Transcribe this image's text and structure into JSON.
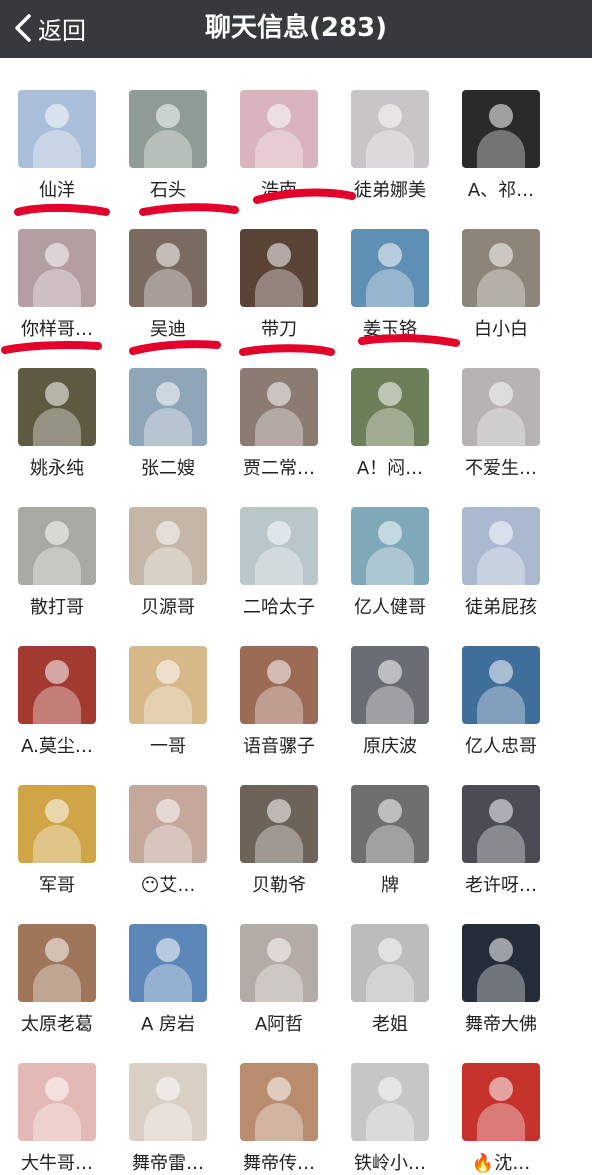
{
  "header": {
    "back_label": "返回",
    "title": "聊天信息(283)"
  },
  "members": [
    {
      "name": "仙洋",
      "color": "#a9bfd9"
    },
    {
      "name": "石头",
      "color": "#8f9b96"
    },
    {
      "name": "浩南",
      "color": "#d9b3bd"
    },
    {
      "name": "徒弟娜美",
      "color": "#c9c4c8"
    },
    {
      "name": "A、祁…",
      "color": "#2a2a2a"
    },
    {
      "name": "你样哥…",
      "color": "#b49ea2"
    },
    {
      "name": "吴迪",
      "color": "#7b6a60"
    },
    {
      "name": "带刀",
      "color": "#5a4438"
    },
    {
      "name": "姜玉铬",
      "color": "#5f8fb3"
    },
    {
      "name": "白小白",
      "color": "#8d8579"
    },
    {
      "name": "姚永纯",
      "color": "#5e5a42"
    },
    {
      "name": "张二嫂",
      "color": "#8fa6b8"
    },
    {
      "name": "贾二常…",
      "color": "#8c7b72"
    },
    {
      "name": "A！闷…",
      "color": "#6d7f58"
    },
    {
      "name": "不爱生…",
      "color": "#b7b3b5"
    },
    {
      "name": "散打哥",
      "color": "#a9a9a3"
    },
    {
      "name": "贝源哥",
      "color": "#c5b7a8"
    },
    {
      "name": "二哈太子",
      "color": "#b9c7cb"
    },
    {
      "name": "亿人健哥",
      "color": "#7fa8b9"
    },
    {
      "name": "徒弟屁孩",
      "color": "#aab8d0"
    },
    {
      "name": "A.莫尘…",
      "color": "#a23a2f"
    },
    {
      "name": "一哥",
      "color": "#d7b889"
    },
    {
      "name": "语音骡子",
      "color": "#9b6b55"
    },
    {
      "name": "原庆波",
      "color": "#6b6d74"
    },
    {
      "name": "亿人忠哥",
      "color": "#3f6e9a"
    },
    {
      "name": "军哥",
      "color": "#d0a548"
    },
    {
      "name": "😶艾…",
      "color": "#c4a89c"
    },
    {
      "name": "贝勒爷",
      "color": "#6e6358"
    },
    {
      "name": "牌",
      "color": "#6f6f6f"
    },
    {
      "name": "老许呀…",
      "color": "#4b4b55"
    },
    {
      "name": "太原老葛",
      "color": "#a0765a"
    },
    {
      "name": "A 房岩",
      "color": "#5d87b8"
    },
    {
      "name": "A阿哲",
      "color": "#b4aba6"
    },
    {
      "name": "老姐",
      "color": "#bcbcbc"
    },
    {
      "name": "舞帝大佛",
      "color": "#262d3a"
    },
    {
      "name": "大牛哥…",
      "color": "#e3b9b5"
    },
    {
      "name": "舞帝雷…",
      "color": "#d9cfc5"
    },
    {
      "name": "舞帝传…",
      "color": "#b88c6c"
    },
    {
      "name": "铁岭小…",
      "color": "#c6c6c6"
    },
    {
      "name": "🔥沈…",
      "color": "#c6332d"
    }
  ],
  "annotation_color": "#e3002b"
}
